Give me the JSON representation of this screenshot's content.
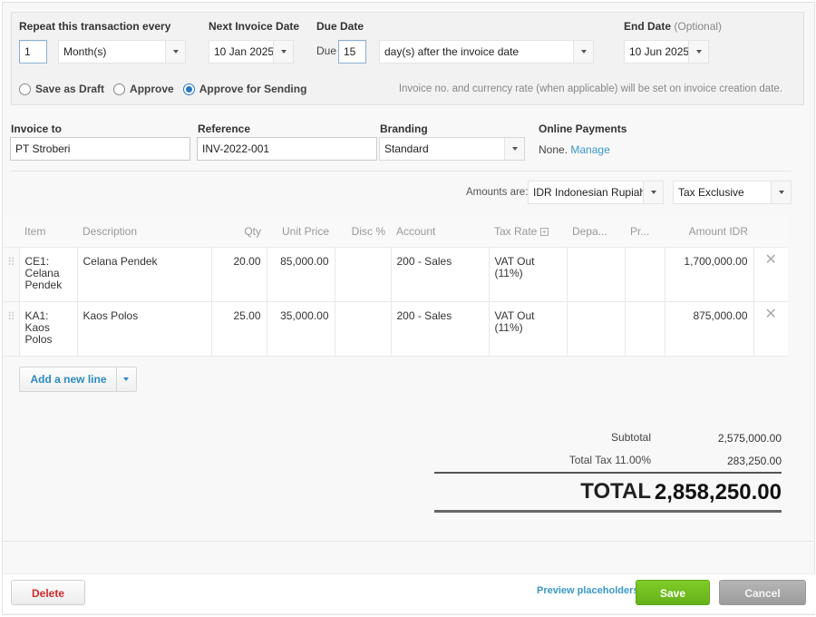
{
  "repeat": {
    "label": "Repeat this transaction every",
    "interval": "1",
    "period": "Month(s)",
    "next_invoice_label": "Next Invoice Date",
    "next_invoice_date": "10 Jan 2025",
    "due_label": "Due Date",
    "due_prefix": "Due",
    "due_days": "15",
    "due_rule": "day(s) after the invoice date",
    "end_label": "End Date",
    "end_optional": "(Optional)",
    "end_date": "10 Jun 2025",
    "status_options": [
      {
        "label": "Save as Draft",
        "selected": false
      },
      {
        "label": "Approve",
        "selected": false
      },
      {
        "label": "Approve for Sending",
        "selected": true
      }
    ],
    "note": "Invoice no. and currency rate (when applicable) will be set on invoice creation date."
  },
  "invoice": {
    "to_label": "Invoice to",
    "to_value": "PT Stroberi",
    "reference_label": "Reference",
    "reference_value": "INV-2022-001",
    "branding_label": "Branding",
    "branding_value": "Standard",
    "payments_label": "Online Payments",
    "payments_value": "None.",
    "payments_link": "Manage"
  },
  "amounts": {
    "label": "Amounts are:",
    "currency": "IDR Indonesian Rupiah",
    "tax_mode": "Tax Exclusive"
  },
  "table": {
    "headers": [
      "Item",
      "Description",
      "Qty",
      "Unit Price",
      "Disc %",
      "Account",
      "Tax Rate",
      "Depa...",
      "Pr...",
      "Amount IDR"
    ],
    "rows": [
      {
        "item": "CE1: Celana Pendek",
        "description": "Celana Pendek",
        "qty": "20.00",
        "unit_price": "85,000.00",
        "disc": "",
        "account": "200 - Sales",
        "tax_rate": "VAT Out (11%)",
        "department": "",
        "project": "",
        "amount": "1,700,000.00"
      },
      {
        "item": "KA1: Kaos Polos",
        "description": "Kaos Polos",
        "qty": "25.00",
        "unit_price": "35,000.00",
        "disc": "",
        "account": "200 - Sales",
        "tax_rate": "VAT Out (11%)",
        "department": "",
        "project": "",
        "amount": "875,000.00"
      }
    ]
  },
  "add_line_label": "Add a new line",
  "totals": {
    "subtotal_label": "Subtotal",
    "subtotal_value": "2,575,000.00",
    "tax_label": "Total Tax 11.00%",
    "tax_value": "283,250.00",
    "total_label": "TOTAL",
    "total_value": "2,858,250.00"
  },
  "footer": {
    "delete_label": "Delete",
    "preview_label": "Preview placeholders",
    "save_label": "Save",
    "cancel_label": "Cancel"
  },
  "colors": {
    "accent_link": "#3a99c8",
    "save_green": "#6cb81e",
    "delete_red": "#d32a2a",
    "radio_selected": "#2a78c4"
  }
}
